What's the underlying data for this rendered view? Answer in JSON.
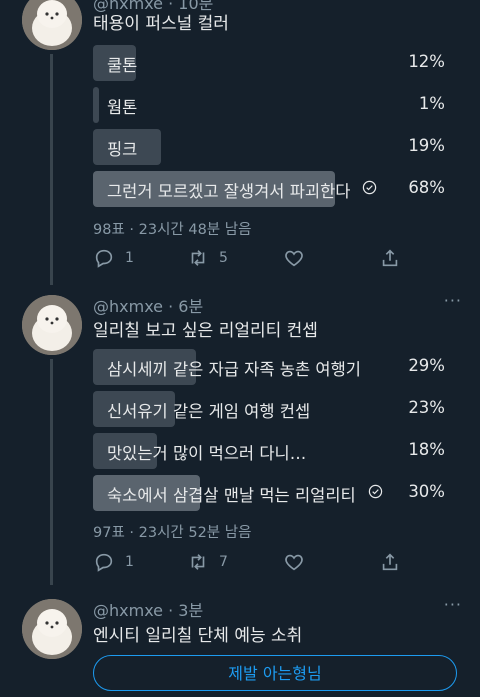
{
  "tweets": [
    {
      "handle": "@hxmxe",
      "time": "10분",
      "text": "태용이 퍼스널 컬러",
      "poll": [
        {
          "label": "쿨톤",
          "pct": "12%",
          "value": 12,
          "winner": false
        },
        {
          "label": "웜톤",
          "pct": "1%",
          "value": 1,
          "winner": false
        },
        {
          "label": "핑크",
          "pct": "19%",
          "value": 19,
          "winner": false
        },
        {
          "label": "그런거 모르겠고 잘생겨서 파괴한다",
          "pct": "68%",
          "value": 68,
          "winner": true
        }
      ],
      "meta": "98표 · 23시간 48분 남음",
      "replies": "1",
      "retweets": "5"
    },
    {
      "handle": "@hxmxe",
      "time": "6분",
      "text": "일리칠 보고 싶은 리얼리티 컨셉",
      "poll": [
        {
          "label": "삼시세끼 같은 자급 자족 농촌 여행기",
          "pct": "29%",
          "value": 29,
          "winner": false
        },
        {
          "label": "신서유기 같은 게임 여행 컨셉",
          "pct": "23%",
          "value": 23,
          "winner": false
        },
        {
          "label": "맛있는거 많이 먹으러 다니…",
          "pct": "18%",
          "value": 18,
          "winner": false
        },
        {
          "label": "숙소에서 삼겹살 맨날 먹는 리얼리티",
          "pct": "30%",
          "value": 30,
          "winner": true
        }
      ],
      "meta": "97표 · 23시간 52분 남음",
      "replies": "1",
      "retweets": "7"
    },
    {
      "handle": "@hxmxe",
      "time": "3분",
      "text": "엔시티 일리칠 단체 예능 소취",
      "button": "제발 아는형님"
    }
  ],
  "icons": {
    "reply": "reply-icon",
    "retweet": "retweet-icon",
    "like": "heart-icon",
    "share": "share-icon",
    "check": "check-circle-icon"
  }
}
